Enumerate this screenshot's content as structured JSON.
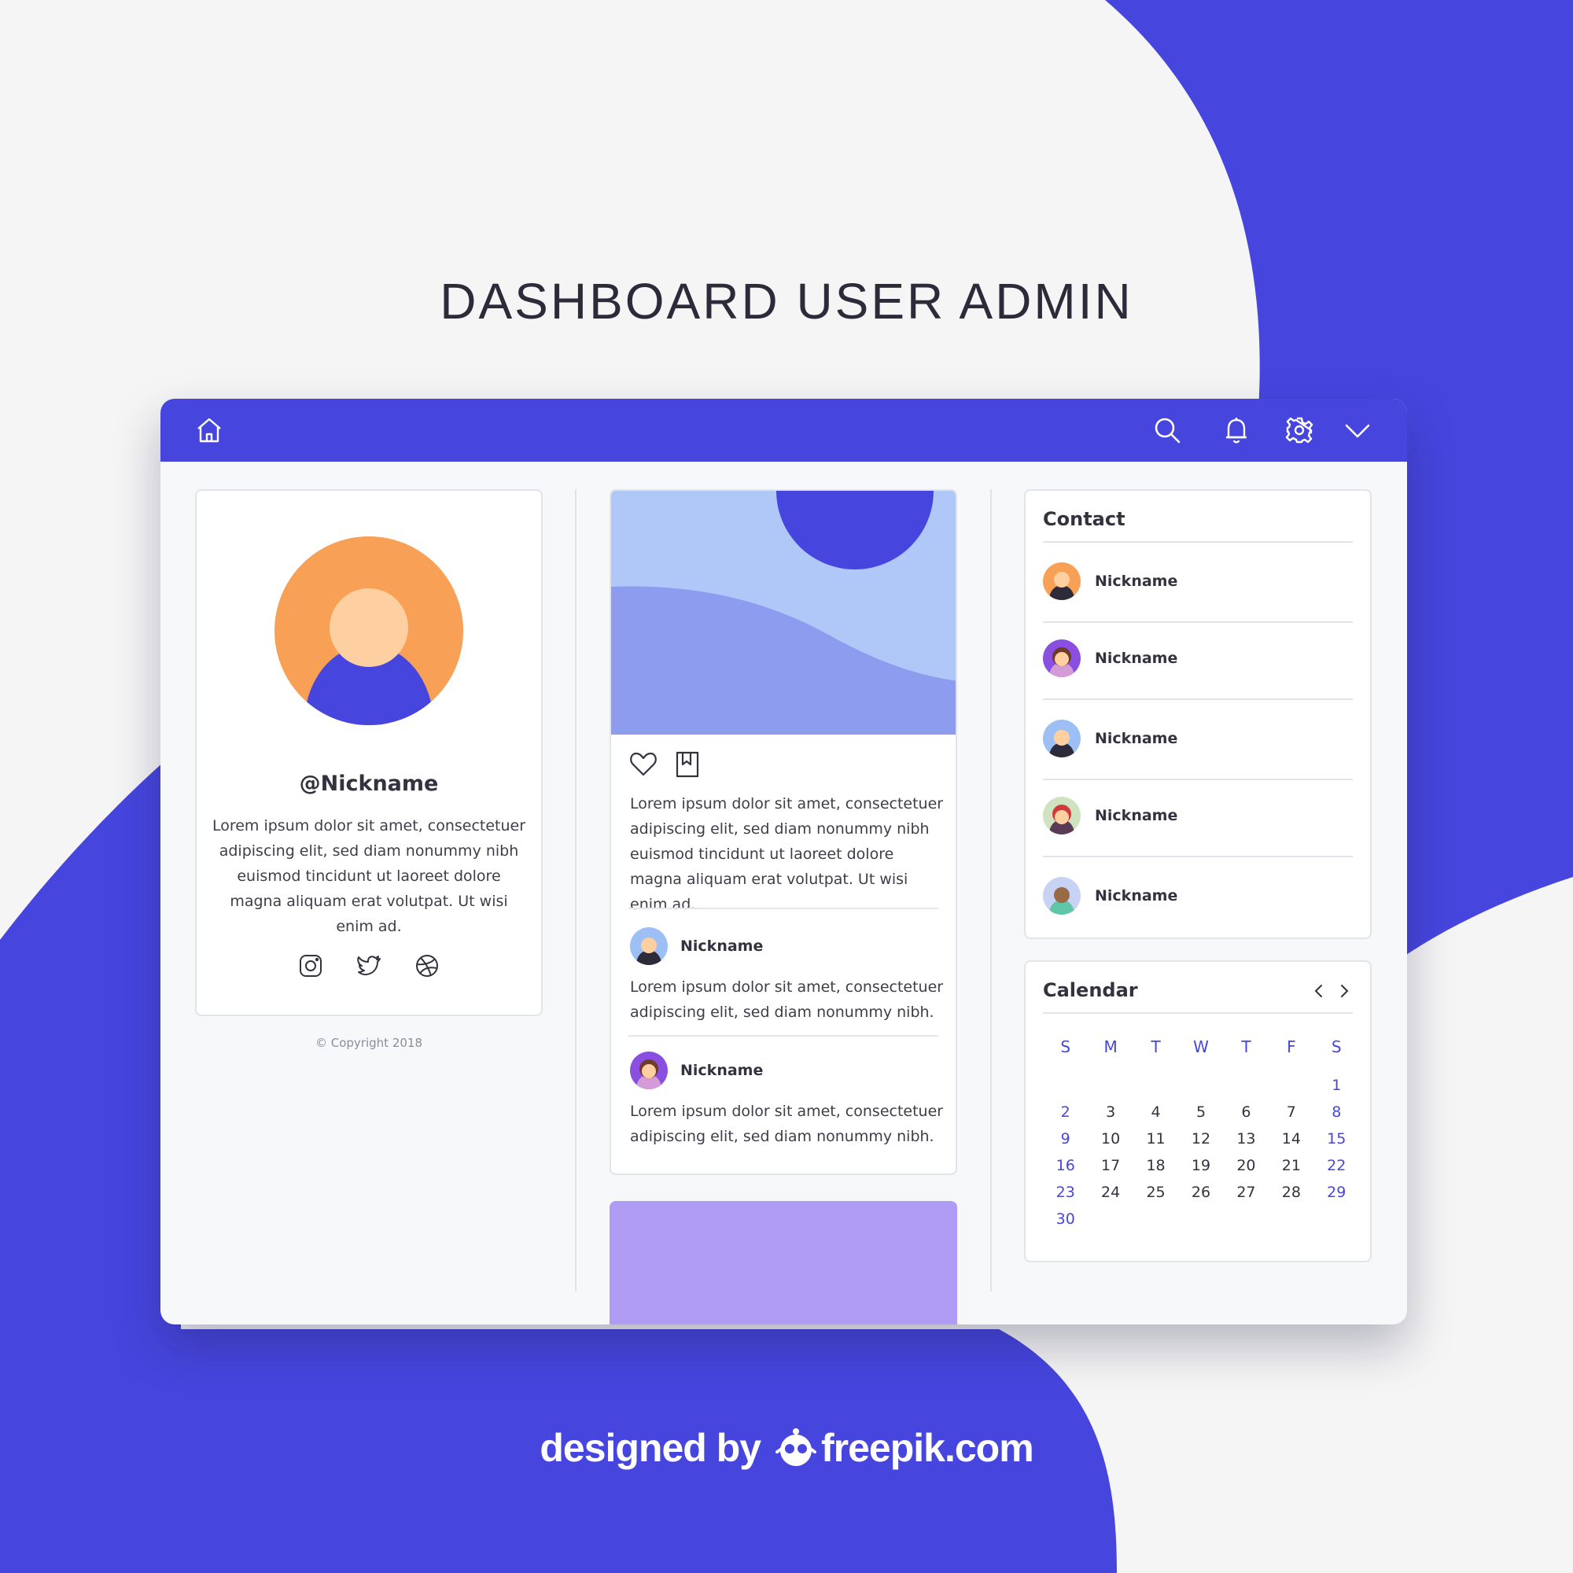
{
  "page": {
    "title": "DASHBOARD USER ADMIN",
    "credit": "designed by freepik.com",
    "credit_prefix": "designed by",
    "credit_brand": "freepik.com"
  },
  "colors": {
    "accent": "#4646df",
    "orange": "#f8a055",
    "skin": "#fecfa0",
    "light_blue": "#b0c8f8",
    "mid_blue": "#8e9cf0",
    "purple": "#b09cf4"
  },
  "topbar": {
    "left_icons": [
      "home-icon"
    ],
    "right_icons": [
      "search-icon",
      "bell-icon",
      "gear-icon",
      "chevron-down-icon"
    ]
  },
  "profile": {
    "nickname": "@Nickname",
    "bio": "Lorem ipsum dolor sit amet, consectetuer adipiscing elit, sed diam nonummy nibh euismod tincidunt ut laoreet dolore magna aliquam erat volutpat. Ut wisi enim ad.",
    "social_icons": [
      "instagram-icon",
      "twitter-icon",
      "dribbble-icon"
    ],
    "copyright": "© Copyright 2018"
  },
  "feed": {
    "post": {
      "action_icons": [
        "heart-icon",
        "bookmark-icon"
      ],
      "text": "Lorem ipsum dolor sit amet, consectetuer adipiscing elit, sed diam nonummy nibh euismod tincidunt ut laoreet dolore magna aliquam erat volutpat. Ut wisi enim ad.",
      "comments": [
        {
          "name": "Nickname",
          "text": "Lorem ipsum dolor sit amet, consectetuer adipiscing elit, sed diam nonummy nibh."
        },
        {
          "name": "Nickname",
          "text": "Lorem ipsum dolor sit amet, consectetuer adipiscing elit, sed diam nonummy nibh."
        }
      ]
    }
  },
  "contact": {
    "title": "Contact",
    "items": [
      {
        "name": "Nickname"
      },
      {
        "name": "Nickname"
      },
      {
        "name": "Nickname"
      },
      {
        "name": "Nickname"
      },
      {
        "name": "Nickname"
      }
    ]
  },
  "calendar": {
    "title": "Calendar",
    "nav_icons": [
      "chevron-left-icon",
      "chevron-right-icon"
    ],
    "weekdays": [
      "S",
      "M",
      "T",
      "W",
      "T",
      "F",
      "S"
    ],
    "weeks": [
      [
        "",
        "",
        "",
        "",
        "",
        "",
        "1"
      ],
      [
        "2",
        "3",
        "4",
        "5",
        "6",
        "7",
        "8"
      ],
      [
        "9",
        "10",
        "11",
        "12",
        "13",
        "14",
        "15"
      ],
      [
        "16",
        "17",
        "18",
        "19",
        "20",
        "21",
        "22"
      ],
      [
        "23",
        "24",
        "25",
        "26",
        "27",
        "28",
        "29"
      ],
      [
        "30",
        "",
        "",
        "",
        "",
        "",
        ""
      ]
    ]
  }
}
